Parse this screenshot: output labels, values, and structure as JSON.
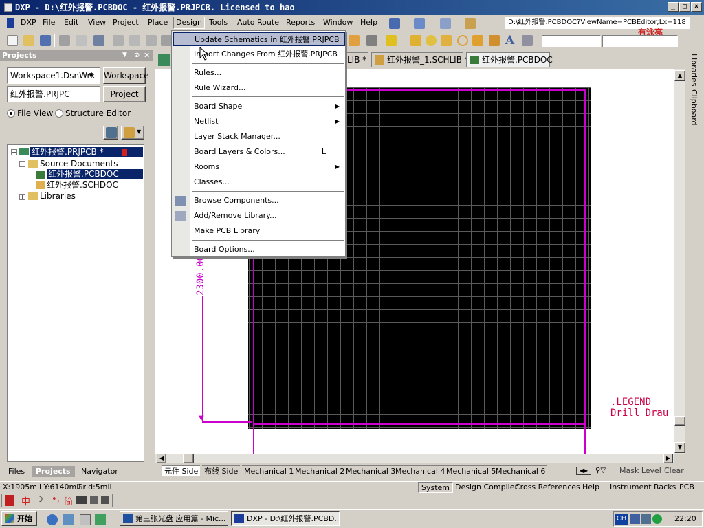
{
  "window": {
    "title": "DXP - D:\\红外报警.PCBDOC - 红外报警.PRJPCB. Licensed to hao",
    "url_field": "D:\\红外报警.PCBDOC?ViewName=PCBEditor;Lx=118"
  },
  "menubar": {
    "items": [
      "DXP",
      "File",
      "Edit",
      "View",
      "Project",
      "Place",
      "Design",
      "Tools",
      "Auto Route",
      "Reports",
      "Window",
      "Help"
    ],
    "active": "Design"
  },
  "projects_panel": {
    "title": "Projects",
    "workspace_value": "Workspace1.DsnWrk",
    "workspace_button": "Workspace",
    "project_value": "红外报警.PRJPC",
    "project_button": "Project",
    "file_view": "File View",
    "structure_editor": "Structure Editor",
    "tree": [
      {
        "label": "红外报警.PRJPCB *",
        "selected": true
      },
      {
        "label": "Source Documents"
      },
      {
        "label": "红外报警.PCBDOC",
        "selected": true
      },
      {
        "label": "红外报警.SCHDOC"
      },
      {
        "label": "Libraries"
      }
    ]
  },
  "doc_tabs": [
    "LIB *",
    "红外报警_1.SCHLIB *",
    "红外报警.PCBDOC"
  ],
  "design_menu": {
    "items": [
      {
        "label": "Update Schematics in 红外报警.PRJPCB",
        "highlight": true
      },
      {
        "label": "Import Changes From 红外报警.PRJPCB"
      },
      {
        "label": "Rules..."
      },
      {
        "label": "Rule Wizard..."
      },
      {
        "label": "Board Shape",
        "submenu": true
      },
      {
        "label": "Netlist",
        "submenu": true
      },
      {
        "label": "Layer Stack Manager..."
      },
      {
        "label": "Board Layers & Colors...",
        "shortcut": "L"
      },
      {
        "label": "Rooms",
        "submenu": true
      },
      {
        "label": "Classes..."
      },
      {
        "label": "Browse Components..."
      },
      {
        "label": "Add/Remove Library..."
      },
      {
        "label": "Make PCB Library"
      },
      {
        "label": "Board Options..."
      }
    ]
  },
  "canvas": {
    "dimension_label": "2300.00",
    "legend_line1": ".LEGEND",
    "legend_line2": "Drill Drau"
  },
  "right_sidebar": {
    "tabs": [
      "Libraries",
      "Clipboard"
    ]
  },
  "bottom_panel_tabs": [
    "Files",
    "Projects",
    "Navigator"
  ],
  "layer_tabs": [
    "元件 Side",
    "布线 Side",
    "Mechanical 1",
    "Mechanical 2",
    "Mechanical 3",
    "Mechanical 4",
    "Mechanical 5",
    "Mechanical 6"
  ],
  "layer_controls": {
    "mask_level": "Mask Level",
    "clear": "Clear"
  },
  "statusbar": {
    "coords": "X:1905mil Y:6140mil",
    "grid": "Grid:5mil",
    "panels": [
      "System",
      "Design Compiler",
      "Cross References",
      "Help",
      "Instrument Racks",
      "PCB"
    ]
  },
  "ime": {
    "chars": "中",
    "simp": "简"
  },
  "watermark": "有泳亮",
  "taskbar": {
    "start": "开始",
    "apps": [
      "第三张光盘 应用篇 - Mic...",
      "DXP - D:\\红外报警.PCBD..."
    ],
    "tray_ch": "CH",
    "clock": "22:20"
  },
  "colors": {
    "title_start": "#0a246a",
    "board": "#000000",
    "outline": "#cc00cc",
    "legend": "#cc0044",
    "highlight": "#b6bdd2"
  }
}
